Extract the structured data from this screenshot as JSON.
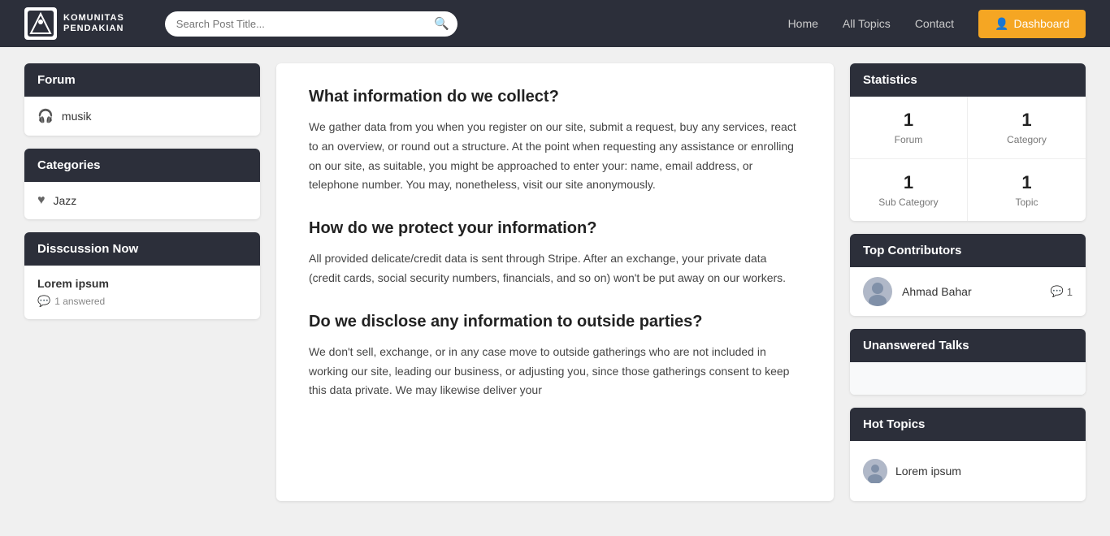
{
  "navbar": {
    "brand_name": "KOMUNITAS\nPENDAKIAN",
    "search_placeholder": "Search Post Title...",
    "nav_home": "Home",
    "nav_all_topics": "All Topics",
    "nav_contact": "Contact",
    "btn_dashboard": "Dashboard"
  },
  "left_sidebar": {
    "forum_header": "Forum",
    "forum_items": [
      {
        "label": "musik",
        "icon": "🎧"
      }
    ],
    "categories_header": "Categories",
    "category_items": [
      {
        "label": "Jazz",
        "icon": "♥"
      }
    ],
    "discussion_header": "Disscussion Now",
    "discussion_items": [
      {
        "title": "Lorem ipsum",
        "answered": "1 answered"
      }
    ]
  },
  "main_content": {
    "sections": [
      {
        "heading": "What information do we collect?",
        "body": "We gather data from you when you register on our site, submit a request, buy any services, react to an overview, or round out a structure. At the point when requesting any assistance or enrolling on our site, as suitable, you might be approached to enter your: name, email address, or telephone number. You may, nonetheless, visit our site anonymously."
      },
      {
        "heading": "How do we protect your information?",
        "body": "All provided delicate/credit data is sent through Stripe. After an exchange, your private data (credit cards, social security numbers, financials, and so on) won't be put away on our workers."
      },
      {
        "heading": "Do we disclose any information to outside parties?",
        "body": "We don't sell, exchange, or in any case move to outside gatherings who are not included in working our site, leading our business, or adjusting you, since those gatherings consent to keep this data private. We may likewise deliver your"
      }
    ]
  },
  "right_sidebar": {
    "statistics_header": "Statistics",
    "stats": [
      {
        "number": "1",
        "label": "Forum"
      },
      {
        "number": "1",
        "label": "Category"
      },
      {
        "number": "1",
        "label": "Sub Category"
      },
      {
        "number": "1",
        "label": "Topic"
      }
    ],
    "top_contributors_header": "Top Contributors",
    "contributors": [
      {
        "name": "Ahmad Bahar",
        "count": "1"
      }
    ],
    "unanswered_header": "Unanswered Talks",
    "hot_topics_header": "Hot Topics",
    "hot_topics": [
      {
        "title": "Lorem ipsum"
      }
    ]
  }
}
